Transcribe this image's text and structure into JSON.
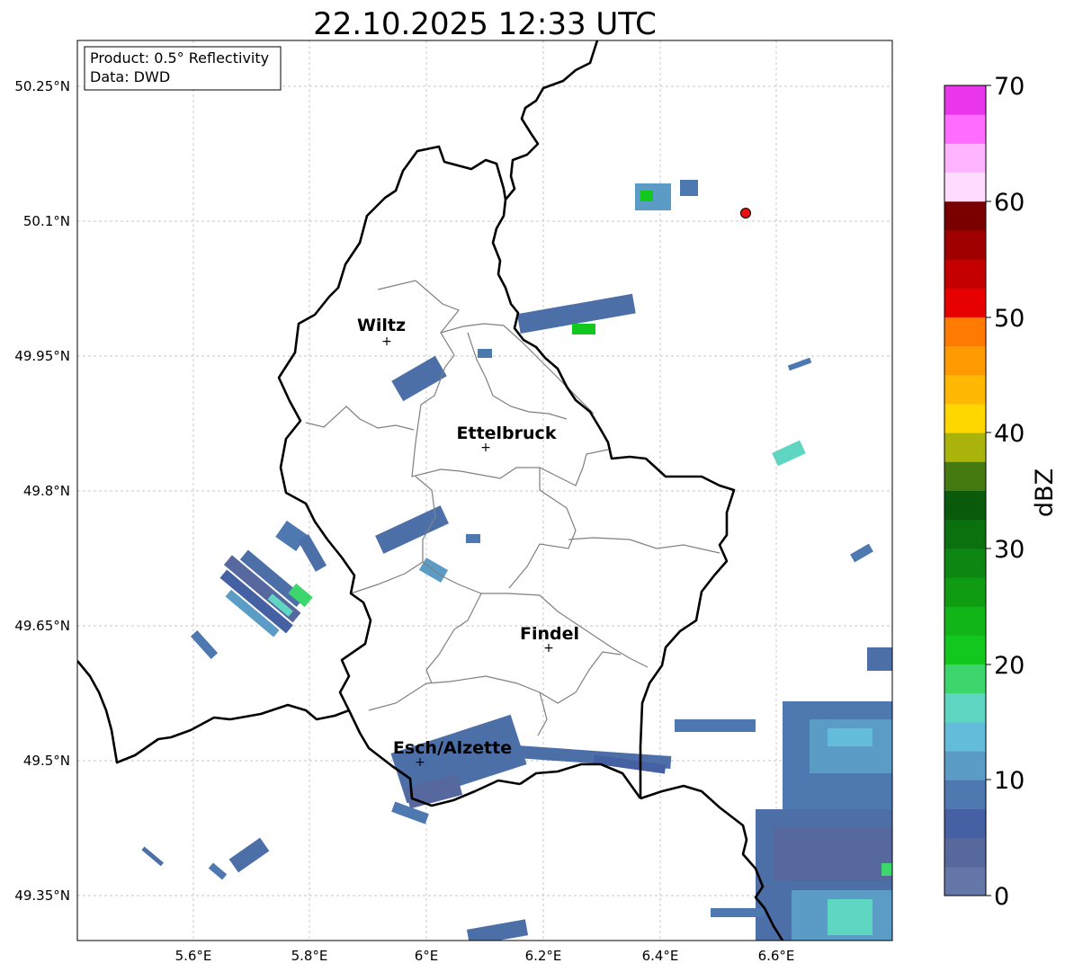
{
  "map": {
    "title": "22.10.2025 12:33 UTC",
    "info_box": {
      "product": "Product: 0.5° Reflectivity",
      "data": "Data: DWD"
    },
    "lat_ticks": [
      "50.25°N",
      "50.1°N",
      "49.95°N",
      "49.8°N",
      "49.65°N",
      "49.5°N",
      "49.35°N"
    ],
    "lon_ticks": [
      "5.6°E",
      "5.8°E",
      "6°E",
      "6.2°E",
      "6.4°E",
      "6.6°E"
    ],
    "places": [
      {
        "name": "Wiltz",
        "lon": 5.93,
        "lat": 49.966
      },
      {
        "name": "Ettelbruck",
        "lon": 6.1,
        "lat": 49.847
      },
      {
        "name": "Findel",
        "lon": 6.21,
        "lat": 49.627
      },
      {
        "name": "Esch/Alzette",
        "lon": 5.99,
        "lat": 49.499
      }
    ],
    "radar_site": {
      "lon": 6.55,
      "lat": 50.11,
      "color": "#e81010"
    },
    "colorbar": {
      "label": "dBZ",
      "ticks": [
        "0",
        "10",
        "20",
        "30",
        "40",
        "50",
        "60",
        "70"
      ],
      "colors": [
        "#6577a8",
        "#56689e",
        "#4560a3",
        "#4d78b0",
        "#5a9cc6",
        "#64bcdb",
        "#5fd6c1",
        "#3dd66c",
        "#12c81e",
        "#11b517",
        "#0f9c12",
        "#0d8711",
        "#0b700e",
        "#095a0b",
        "#447a10",
        "#aab30a",
        "#ffd700",
        "#ffb905",
        "#ff9a00",
        "#ff7a00",
        "#e60000",
        "#c40000",
        "#a00000",
        "#7a0000",
        "#ffdcff",
        "#ffb4ff",
        "#ff6cff",
        "#ea36ea"
      ]
    }
  }
}
